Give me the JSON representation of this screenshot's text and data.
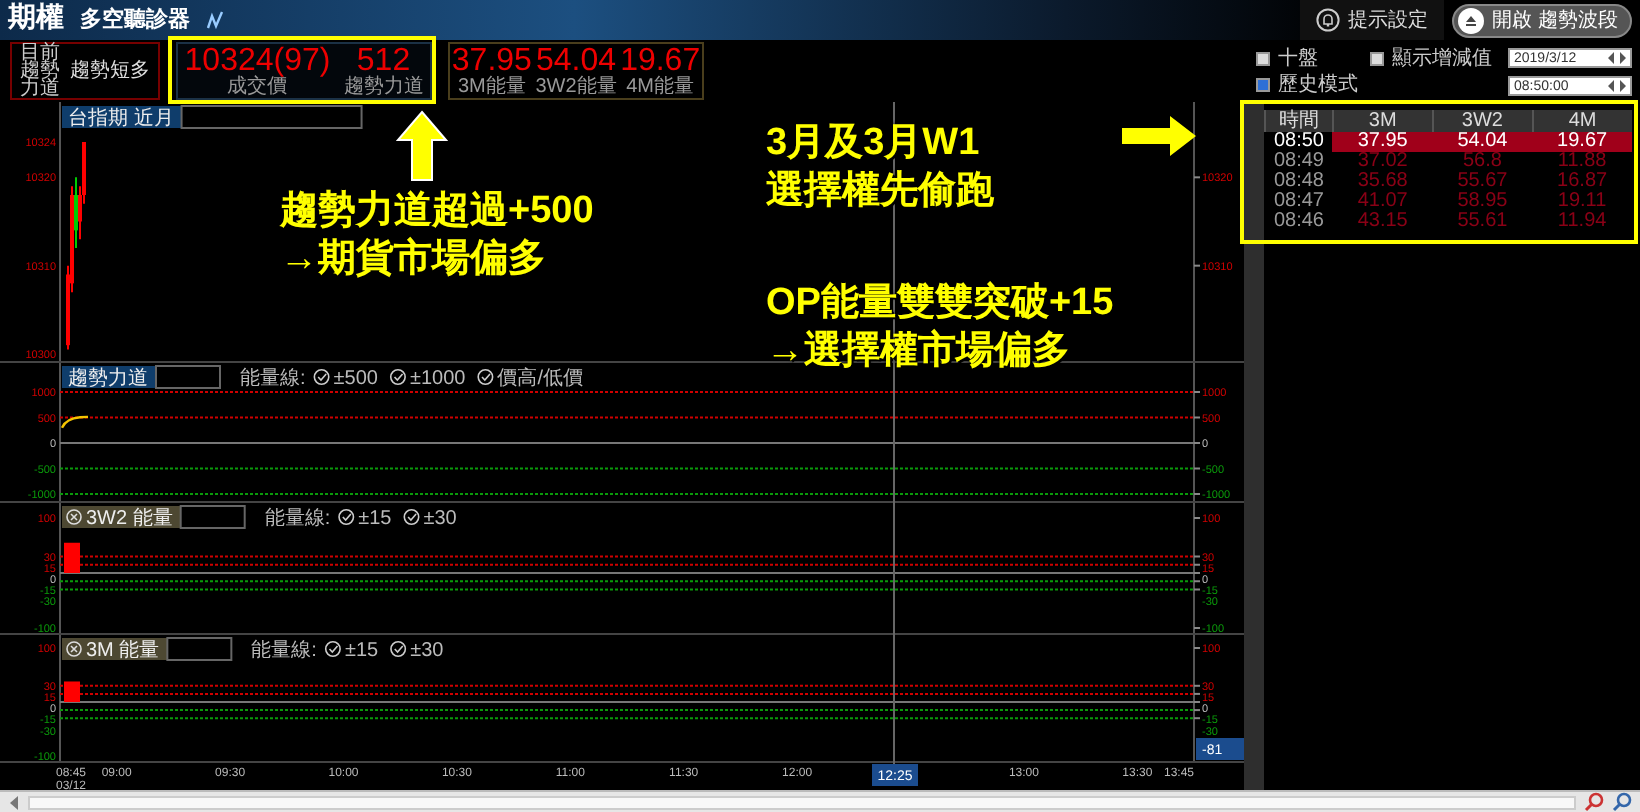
{
  "app": {
    "title": "期權",
    "subtitle": "多空聽診器"
  },
  "alert_button": {
    "label": "提示設定"
  },
  "trend_toggle": {
    "label": "開啟 趨勢波段"
  },
  "status": {
    "label_lines": [
      "目前",
      "趨勢",
      "力道"
    ],
    "value": "趨勢短多"
  },
  "quotes": [
    {
      "value": "10324(97)",
      "label": "成交價"
    },
    {
      "value": "512",
      "label": "趨勢力道"
    }
  ],
  "energy": [
    {
      "value": "37.95",
      "label": "3M能量"
    },
    {
      "value": "54.04",
      "label": "3W2能量"
    },
    {
      "value": "19.67",
      "label": "4M能量"
    }
  ],
  "options": [
    {
      "label": "十盤",
      "checked": false
    },
    {
      "label": "顯示增減值",
      "checked": false
    },
    {
      "label": "歷史模式",
      "checked": true
    }
  ],
  "date": "2019/3/12",
  "time": "08:50:00",
  "table": {
    "columns": [
      "時間",
      "3M",
      "3W2",
      "4M"
    ],
    "rows": [
      {
        "selected": true,
        "cells": [
          "08:50",
          "37.95",
          "54.04",
          "19.67"
        ]
      },
      {
        "selected": false,
        "cells": [
          "08:49",
          "37.02",
          "56.8",
          "11.88"
        ]
      },
      {
        "selected": false,
        "cells": [
          "08:48",
          "35.68",
          "55.67",
          "16.87"
        ]
      },
      {
        "selected": false,
        "cells": [
          "08:47",
          "41.07",
          "58.95",
          "19.11"
        ]
      },
      {
        "selected": false,
        "cells": [
          "08:46",
          "43.15",
          "55.61",
          "11.94"
        ]
      }
    ]
  },
  "panels": [
    {
      "kind": "price",
      "title": "台指期 近月",
      "ticks": [
        "10324",
        "10320",
        "10310",
        "10300"
      ],
      "right_ticks": [
        "10320",
        "10310"
      ]
    },
    {
      "kind": "trend",
      "title": "趨勢力道",
      "legend_label": "能量線:",
      "legend": [
        {
          "label": "±500",
          "checked": true
        },
        {
          "label": "±1000",
          "checked": true
        },
        {
          "label": "價高/低價",
          "checked": true
        }
      ],
      "ticks": [
        "1000",
        "500",
        "0",
        "-500",
        "-1000"
      ],
      "right_ticks": [
        "1000",
        "500",
        "0",
        "-500",
        "-1000"
      ]
    },
    {
      "kind": "energy",
      "title": "3W2 能量",
      "legend_label": "能量線:",
      "legend": [
        {
          "label": "±15",
          "checked": true
        },
        {
          "label": "±30",
          "checked": true
        }
      ],
      "ticks": [
        "100",
        "30",
        "15",
        "0",
        "-15",
        "-30",
        "-100"
      ],
      "right_ticks": [
        "100",
        "30",
        "15",
        "0",
        "-15",
        "-30",
        "-100"
      ]
    },
    {
      "kind": "energy",
      "title": "3M 能量",
      "legend_label": "能量線:",
      "legend": [
        {
          "label": "±15",
          "checked": true
        },
        {
          "label": "±30",
          "checked": true
        }
      ],
      "ticks": [
        "100",
        "30",
        "15",
        "0",
        "-15",
        "-30",
        "-100"
      ],
      "right_ticks": [
        "100",
        "30",
        "15",
        "0",
        "-15",
        "-30"
      ]
    }
  ],
  "time_axis": [
    {
      "label": "08:45",
      "date": "03/12"
    },
    {
      "label": "09:00"
    },
    {
      "label": "09:30"
    },
    {
      "label": "10:00"
    },
    {
      "label": "10:30"
    },
    {
      "label": "11:00"
    },
    {
      "label": "11:30"
    },
    {
      "label": "12:00"
    },
    {
      "label": "13:00"
    },
    {
      "label": "13:30"
    },
    {
      "label": "13:45"
    }
  ],
  "crosshair": {
    "time": "12:25",
    "value": "-81"
  },
  "notes": [
    "趨勢力道超過+500\n→期貨市場偏多",
    "3月及3月W1\n選擇權先偷跑",
    "OP能量雙雙突破+15\n→選擇權市場偏多"
  ]
}
